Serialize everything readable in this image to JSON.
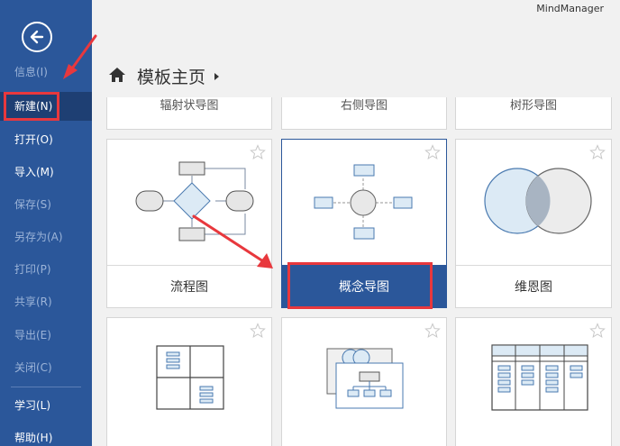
{
  "app": {
    "title": "MindManager"
  },
  "sidebar": {
    "items": [
      {
        "label": "信息(I)",
        "state": "dim"
      },
      {
        "label": "新建(N)",
        "state": "active"
      },
      {
        "label": "打开(O)",
        "state": "normal"
      },
      {
        "label": "导入(M)",
        "state": "normal"
      },
      {
        "label": "保存(S)",
        "state": "dim"
      },
      {
        "label": "另存为(A)",
        "state": "dim"
      },
      {
        "label": "打印(P)",
        "state": "dim"
      },
      {
        "label": "共享(R)",
        "state": "dim"
      },
      {
        "label": "导出(E)",
        "state": "dim"
      },
      {
        "label": "关闭(C)",
        "state": "dim"
      },
      {
        "label": "学习(L)",
        "state": "normal"
      },
      {
        "label": "帮助(H)",
        "state": "normal"
      }
    ]
  },
  "header": {
    "title": "模板主页"
  },
  "templates_partial": [
    "辐射状导图",
    "右侧导图",
    "树形导图"
  ],
  "templates": [
    {
      "label": "流程图",
      "selected": false
    },
    {
      "label": "概念导图",
      "selected": true
    },
    {
      "label": "维恩图",
      "selected": false
    }
  ],
  "colors": {
    "sidebar": "#2b579a",
    "accent": "#2b579a",
    "annotation": "#e8383d"
  }
}
